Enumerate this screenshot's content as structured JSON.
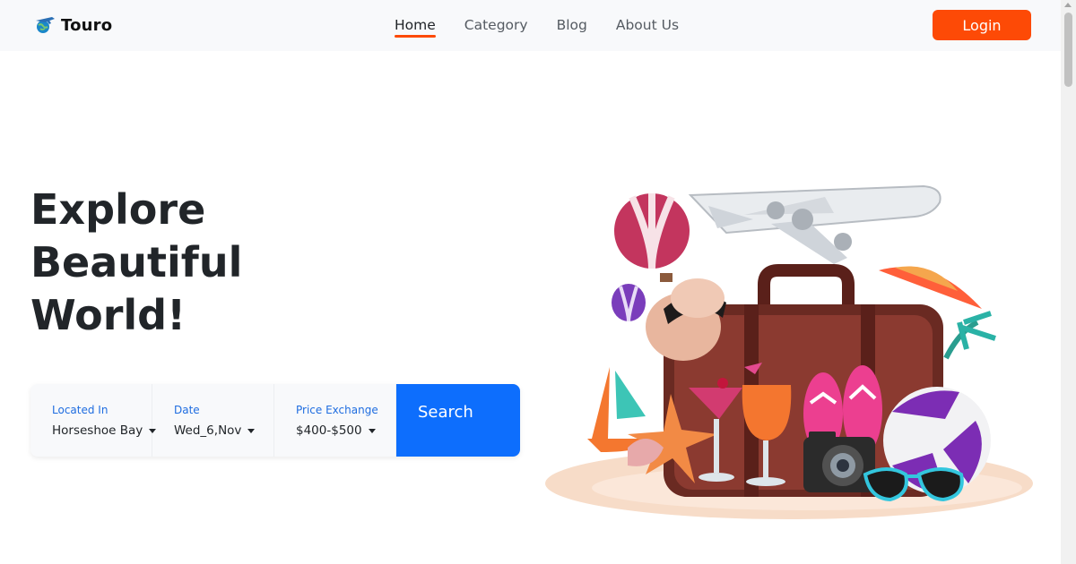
{
  "brand": {
    "name": "Touro",
    "logo_icon": "globe-plane-icon"
  },
  "nav": {
    "items": [
      {
        "label": "Home",
        "active": true
      },
      {
        "label": "Category",
        "active": false
      },
      {
        "label": "Blog",
        "active": false
      },
      {
        "label": "About Us",
        "active": false
      }
    ],
    "login_label": "Login"
  },
  "hero": {
    "title_lines": [
      "Explore",
      "Beautiful",
      "World!"
    ]
  },
  "search": {
    "fields": [
      {
        "label": "Located In",
        "value": "Horseshoe Bay"
      },
      {
        "label": "Date",
        "value": "Wed_6,Nov"
      },
      {
        "label": "Price Exchange",
        "value": "$400-$500"
      }
    ],
    "button_label": "Search"
  },
  "colors": {
    "accent": "#fd4a06",
    "primary": "#0d6efd",
    "navbar_bg": "#f8f9fb",
    "label_blue": "#1f6de0"
  }
}
